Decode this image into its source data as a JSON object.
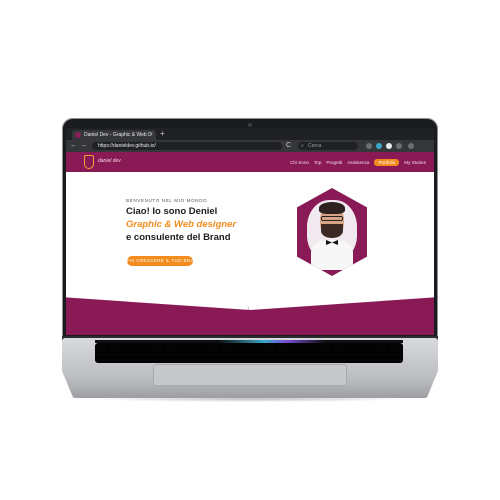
{
  "browser": {
    "tab_title": "Daniel Dev - Graphic & Web D",
    "new_tab": "+",
    "url": "https://danieldev.github.io/",
    "search_placeholder": "Cerca",
    "nav_back": "←",
    "nav_forward": "→",
    "reload": "C"
  },
  "site": {
    "logo_text": "daniel dev",
    "nav": [
      {
        "label": "Chi Sono"
      },
      {
        "label": "Top"
      },
      {
        "label": "Progetti"
      },
      {
        "label": "Assistenza"
      },
      {
        "label": "Portfolio"
      },
      {
        "label": "My Stories"
      }
    ],
    "hero": {
      "kicker": "BENVENUTO NEL MIO MONDO",
      "line1": "Ciao! Io sono Deniel",
      "line2": "Graphic & Web designer",
      "line3": "e consulente del Brand",
      "cta": "FAI CRESCERE IL TUO BRAND"
    },
    "scroll_icon": "↓"
  },
  "colors": {
    "brand": "#8a1a55",
    "accent": "#f28c1e",
    "browser_dark": "#202124"
  }
}
